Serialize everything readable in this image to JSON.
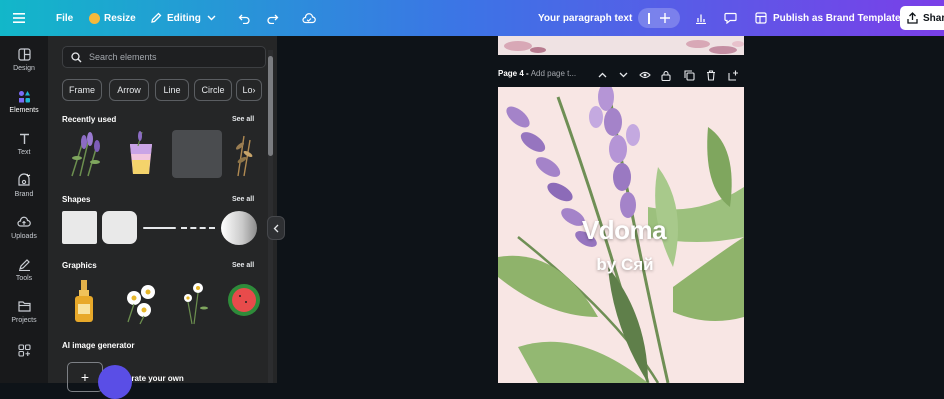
{
  "topbar": {
    "menu_icon": "hamburger-icon",
    "file": "File",
    "resize": "Resize",
    "editing": "Editing",
    "paragraph": "Your paragraph text",
    "publish": "Publish as Brand Template",
    "share": "Shar",
    "colors": {
      "start": "#12b7c9",
      "mid": "#3d73e6",
      "end": "#7a3fe8"
    }
  },
  "rail": {
    "items": [
      {
        "label": "Design",
        "icon": "layout-icon"
      },
      {
        "label": "Elements",
        "icon": "shapes-icon"
      },
      {
        "label": "Text",
        "icon": "text-icon"
      },
      {
        "label": "Brand",
        "icon": "brand-crown-icon"
      },
      {
        "label": "Uploads",
        "icon": "cloud-upload-icon"
      },
      {
        "label": "Tools",
        "icon": "draw-icon"
      },
      {
        "label": "Projects",
        "icon": "folder-icon"
      },
      {
        "label": "Apps",
        "icon": "apps-icon"
      }
    ]
  },
  "panel": {
    "search_placeholder": "Search elements",
    "chips": [
      "Frame",
      "Arrow",
      "Line",
      "Circle",
      "Lo"
    ],
    "recently_used": "Recently used",
    "shapes": "Shapes",
    "graphics": "Graphics",
    "see_all": "See all",
    "ai_title": "AI image generator",
    "ai_generate": "nerate your own"
  },
  "page": {
    "label": "Page 4 -",
    "title_placeholder": "Add page t...",
    "brand_title": "Vdoma",
    "brand_sub": "by Сяй",
    "background": "#f8e6e4"
  }
}
